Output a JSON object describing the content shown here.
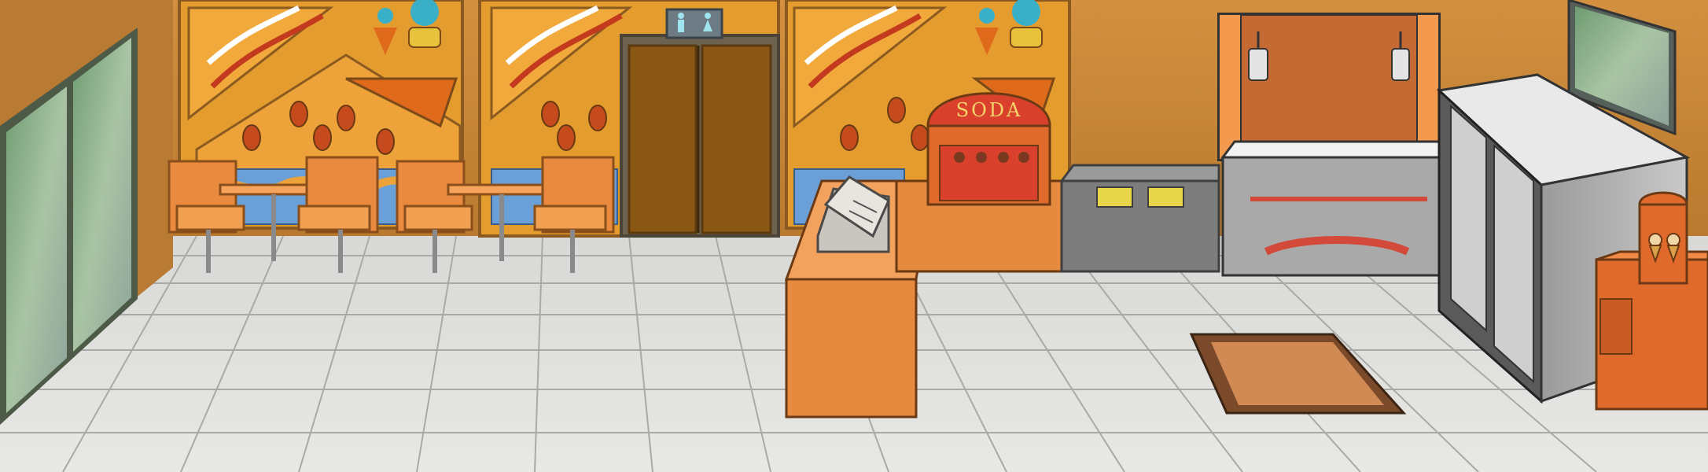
{
  "scene": {
    "soda_sign_text": "SODA",
    "colors": {
      "wall": "#c98a3a",
      "orange": "#e98a3f",
      "dark_orange": "#c8692a",
      "red": "#d9412c",
      "floor": "#dcdcda",
      "steel": "#8e8e8e",
      "glass": "#7fa889"
    },
    "icons": [
      "restroom-icon",
      "soda-fountain-icon",
      "ice-cream-cone-icon",
      "cash-register-icon",
      "frying-pan-icon"
    ]
  }
}
